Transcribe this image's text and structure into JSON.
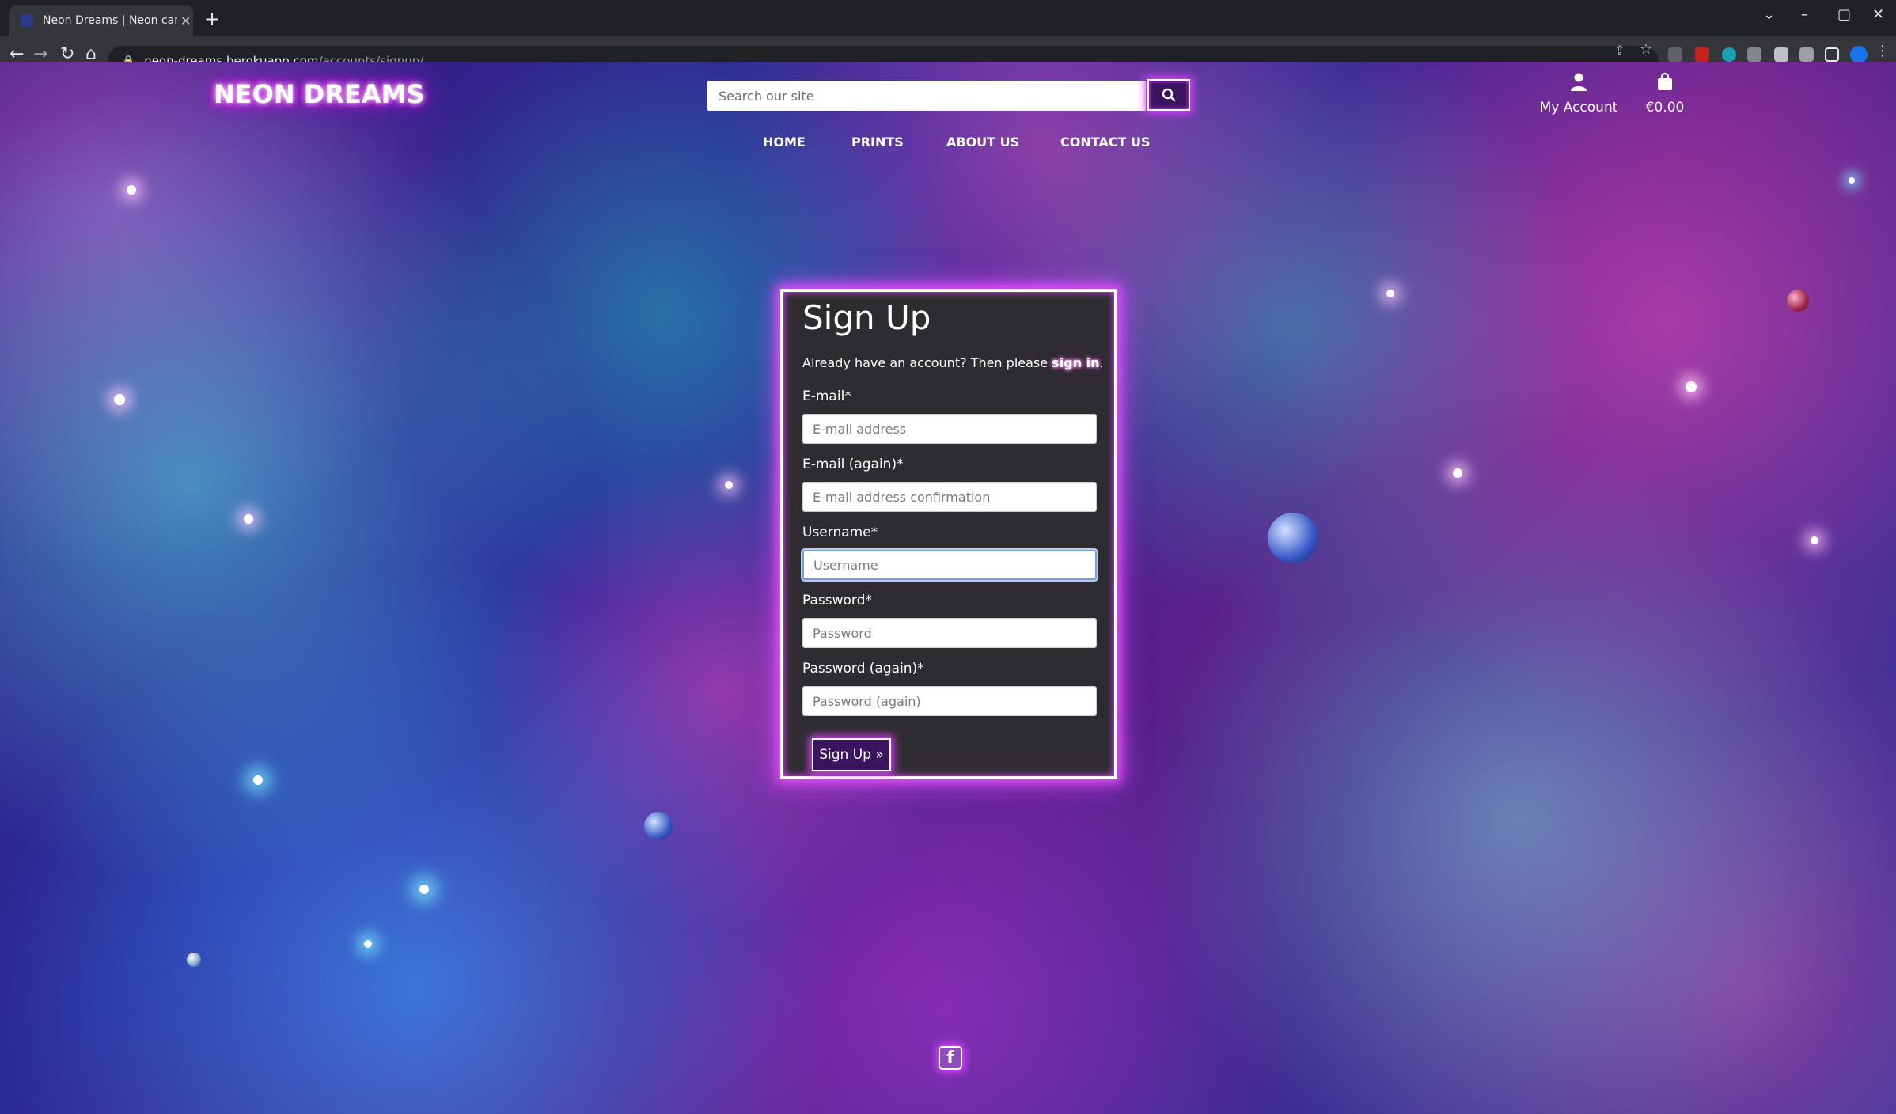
{
  "browser": {
    "tab_title": "Neon Dreams | Neon canvas prin",
    "tab_close": "✕",
    "new_tab": "+",
    "url_host": "neon-dreams.herokuapp.com",
    "url_path": "/accounts/signup/"
  },
  "header": {
    "logo": "NEON DREAMS",
    "search_placeholder": "Search our site",
    "account_label": "My Account",
    "bag_total": "€0.00",
    "nav": {
      "home": "HOME",
      "prints": "PRINTS",
      "about": "ABOUT US",
      "contact": "CONTACT US"
    }
  },
  "signup": {
    "title": "Sign Up",
    "already_text": "Already have an account? Then please ",
    "signin_link": "sign in",
    "already_end": ".",
    "email_label": "E-mail*",
    "email_placeholder": "E-mail address",
    "email2_label": "E-mail (again)*",
    "email2_placeholder": "E-mail address confirmation",
    "username_label": "Username*",
    "username_placeholder": "Username",
    "password_label": "Password*",
    "password_placeholder": "Password",
    "password2_label": "Password (again)*",
    "password2_placeholder": "Password (again)",
    "submit_label": "Sign Up »"
  },
  "footer": {
    "facebook_glyph": "f"
  },
  "theme": {
    "neon_glow": "#e040ff",
    "button_bg": "#3b1460",
    "card_bg": "#2e2c31"
  }
}
